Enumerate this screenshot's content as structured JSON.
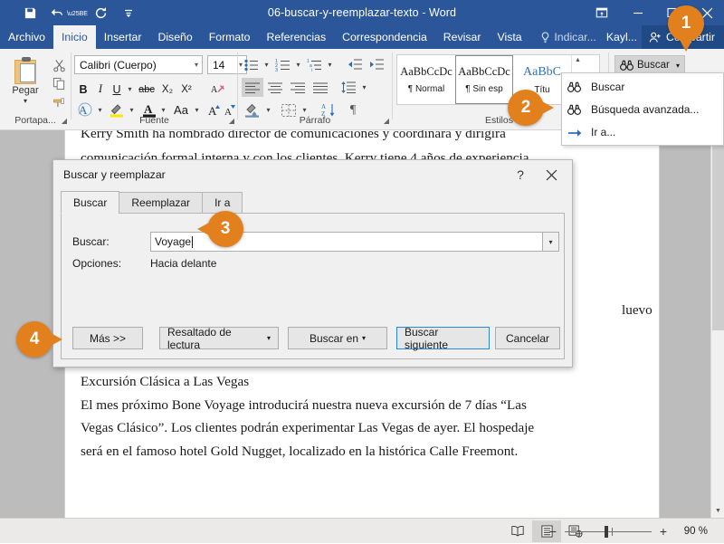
{
  "titlebar": {
    "document_title": "06-buscar-y-reemplazar-texto  -  Word",
    "quick_access": [
      {
        "name": "save-icon",
        "glyph": "💾"
      },
      {
        "name": "undo-icon",
        "glyph": "↶"
      },
      {
        "name": "redo-icon",
        "glyph": "↻"
      },
      {
        "name": "customize-qat-icon",
        "glyph": "⌄"
      }
    ],
    "window_controls": {
      "ribbon_display_options": "⤒",
      "minimize": "—",
      "maximize": "☐",
      "close": "✕"
    }
  },
  "ribbon_tabs": {
    "items": [
      {
        "label": "Archivo",
        "active": false
      },
      {
        "label": "Inicio",
        "active": true
      },
      {
        "label": "Insertar",
        "active": false
      },
      {
        "label": "Diseño",
        "active": false
      },
      {
        "label": "Formato",
        "active": false
      },
      {
        "label": "Referencias",
        "active": false
      },
      {
        "label": "Correspondencia",
        "active": false
      },
      {
        "label": "Revisar",
        "active": false
      },
      {
        "label": "Vista",
        "active": false
      }
    ],
    "tell_me": "Indicar...",
    "account": "Kayl...",
    "share": "Compartir"
  },
  "ribbon": {
    "clipboard": {
      "group_label": "Portapa...",
      "paste_label": "Pegar",
      "cut_icon": "✂",
      "copy_icon": "⧉",
      "format_painter_icon": "🖌"
    },
    "font": {
      "group_label": "Fuente",
      "font_name": "Calibri (Cuerpo)",
      "font_size": "14",
      "bold": "B",
      "italic": "I",
      "underline": "U",
      "strikethrough": "abc",
      "subscript": "X₂",
      "superscript": "X²",
      "clear_formatting": "A",
      "text_effects": "A",
      "highlight": "ab",
      "font_color": "A",
      "change_case": "Aa",
      "grow_font": "A",
      "shrink_font": "A"
    },
    "paragraph": {
      "group_label": "Párrafo",
      "bullets": "•—",
      "numbering": "1—",
      "multilevel": "≡",
      "decrease_indent": "←≡",
      "increase_indent": "→≡",
      "align_left": "≡",
      "align_center": "≡",
      "align_right": "≡",
      "justify": "≡",
      "line_spacing": "↕≡",
      "shading": "▣",
      "borders": "⌷",
      "sort": "A↓Z",
      "show_marks": "¶"
    },
    "styles": {
      "group_label": "Estilos",
      "items": [
        {
          "preview": "AaBbCcDc",
          "name": "¶ Normal",
          "selected": false,
          "blue": false
        },
        {
          "preview": "AaBbCcDc",
          "name": "¶ Sin esp",
          "selected": true,
          "blue": false
        },
        {
          "preview": "AaBbC",
          "name": "Títu",
          "selected": false,
          "blue": true
        }
      ]
    },
    "editing": {
      "find_button": "Buscar",
      "find_icon": "binoculars-icon"
    }
  },
  "find_menu": {
    "items": [
      {
        "label": "Buscar",
        "icon": "binoculars-icon",
        "underline": "c"
      },
      {
        "label": "Búsqueda avanzada...",
        "icon": "binoculars-icon",
        "underline": "a"
      },
      {
        "label": "Ir a...",
        "icon": "arrow-right-icon",
        "underline": "I"
      }
    ]
  },
  "document": {
    "clipped_line_top": "Kerry Smith ha nombrado director de comunicaciones y coordinará y dirigirá",
    "line_visible": "comunicación formal interna y con los clientes. Kerry tiene 4 años de experiencia",
    "hidden_fragment": "luevo",
    "lower_paragraph": {
      "heading": "Excursión Clásica a Las Vegas",
      "lines": [
        "El mes próximo Bone Voyage introducirá nuestra nueva excursión de 7 días “Las",
        "Vegas Clásico”. Los clientes podrán experimentar Las Vegas de ayer. El hospedaje",
        "será en el famoso hotel Gold Nugget, localizado en la histórica Calle Freemont."
      ]
    }
  },
  "dialog": {
    "title": "Buscar y reemplazar",
    "help_glyph": "?",
    "close_glyph": "✕",
    "tabs": [
      {
        "label": "Buscar",
        "active": true
      },
      {
        "label": "Reemplazar",
        "active": false
      },
      {
        "label": "Ir a",
        "active": false
      }
    ],
    "find_label": "Buscar:",
    "find_value": "Voyage",
    "options_label": "Opciones:",
    "options_value": "Hacia delante",
    "buttons": [
      {
        "label": "Más >>",
        "dropdown": false,
        "primary": false
      },
      {
        "label": "Resaltado de lectura",
        "dropdown": true,
        "primary": false
      },
      {
        "label": "Buscar en",
        "dropdown": true,
        "primary": false
      },
      {
        "label": "Buscar siguiente",
        "dropdown": false,
        "primary": true
      },
      {
        "label": "Cancelar",
        "dropdown": false,
        "primary": false
      }
    ]
  },
  "statusbar": {
    "views": [
      {
        "name": "read-mode-icon",
        "glyph": "📖",
        "active": false
      },
      {
        "name": "print-layout-icon",
        "glyph": "▤",
        "active": true
      },
      {
        "name": "web-layout-icon",
        "glyph": "▥",
        "active": false
      }
    ],
    "zoom_out": "−",
    "zoom_in": "+",
    "zoom_level": "90 %"
  },
  "callouts": [
    {
      "number": "1",
      "tail": "down"
    },
    {
      "number": "2",
      "tail": "right"
    },
    {
      "number": "3",
      "tail": "left"
    },
    {
      "number": "4",
      "tail": "right"
    }
  ],
  "colors": {
    "word_blue": "#2b579a",
    "word_blue_dark": "#204a86",
    "callout_orange": "#e2801e",
    "ribbon_bg": "#f2f2f2",
    "doc_bg": "#bcbcbc"
  }
}
